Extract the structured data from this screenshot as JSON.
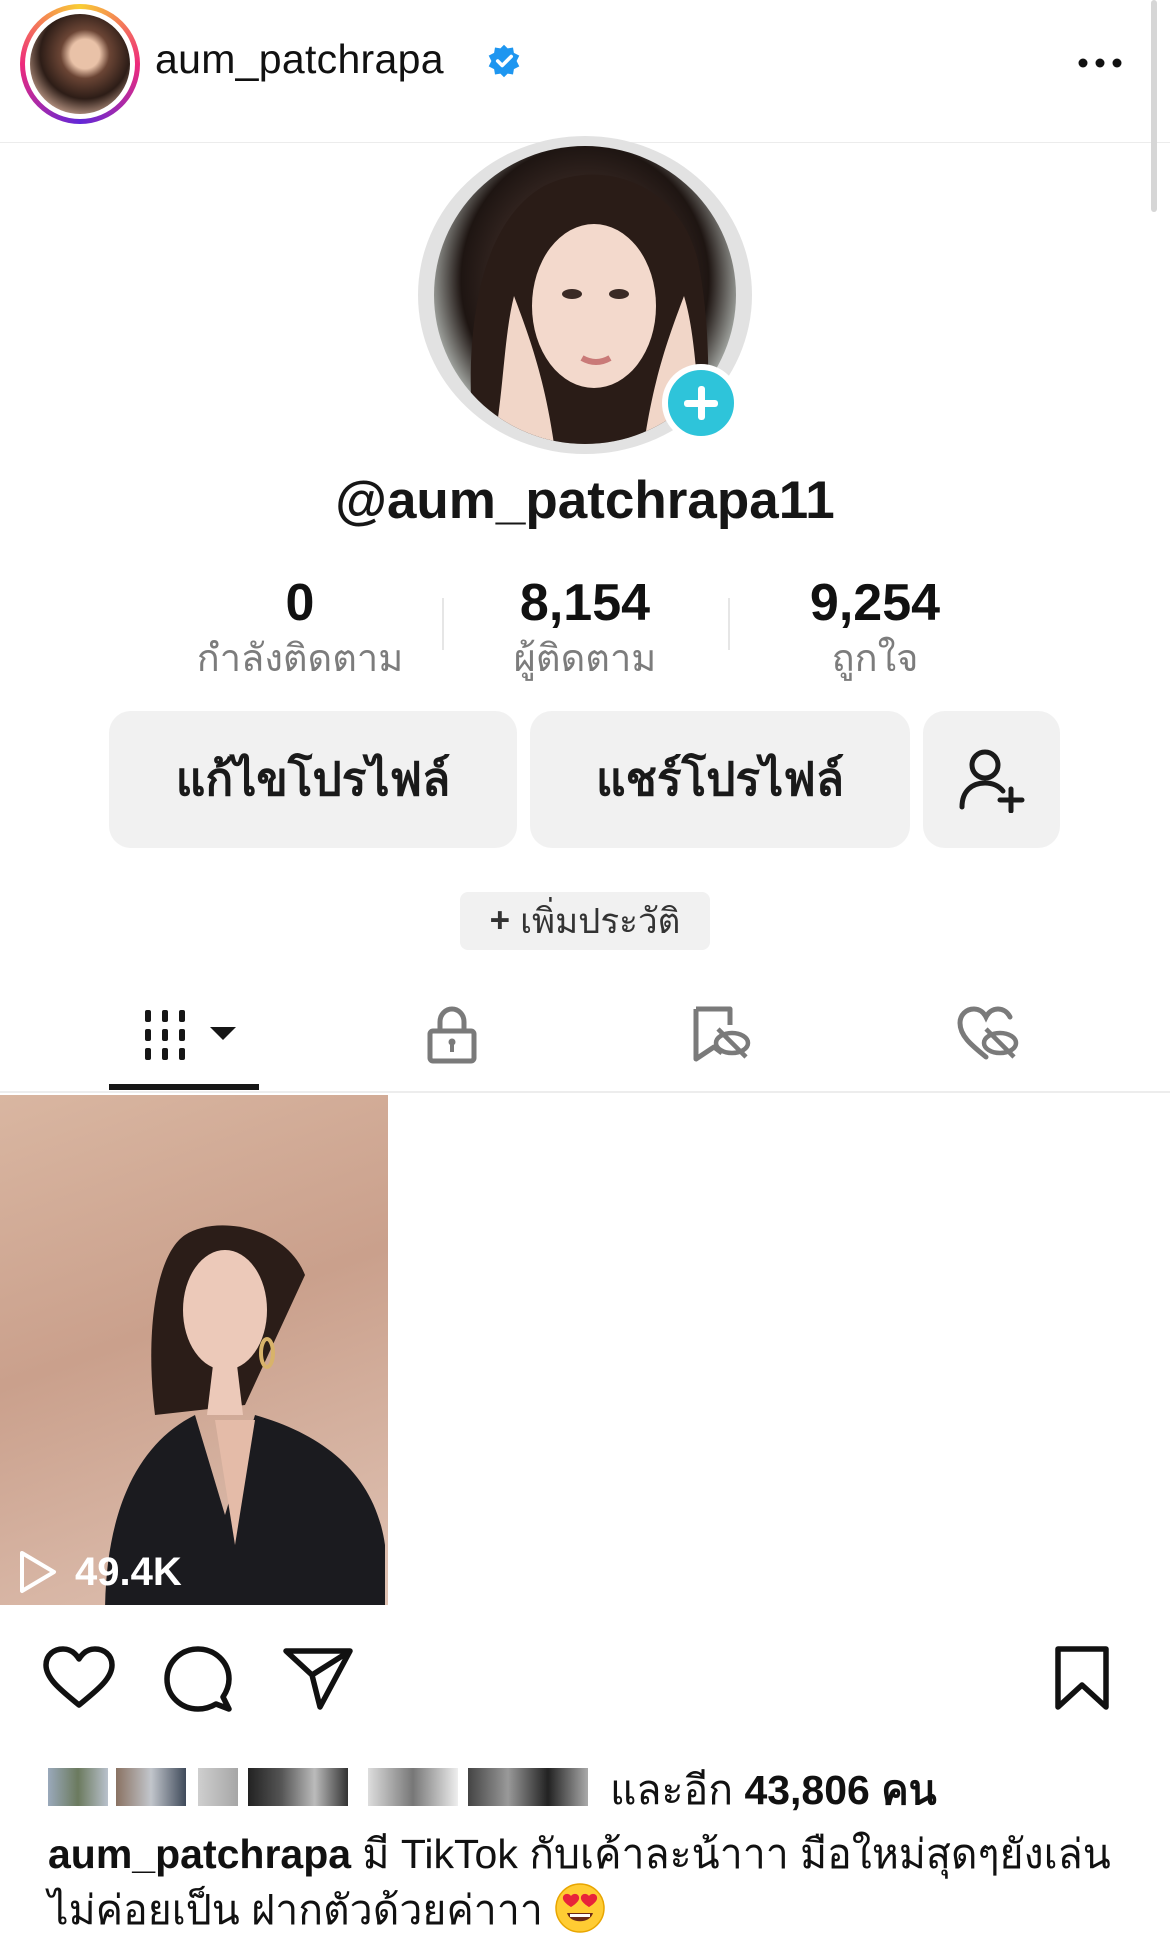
{
  "ig_header": {
    "username": "aum_patchrapa",
    "verified": true,
    "more_icon": "more-horizontal-icon"
  },
  "tiktok_profile": {
    "handle": "@aum_patchrapa11",
    "stats": [
      {
        "value": "0",
        "label": "กำลังติดตาม"
      },
      {
        "value": "8,154",
        "label": "ผู้ติดตาม"
      },
      {
        "value": "9,254",
        "label": "ถูกใจ"
      }
    ],
    "buttons": {
      "edit_profile": "แก้ไขโปรไฟล์",
      "share_profile": "แชร์โปรไฟล์",
      "add_friend_icon": "add-person-icon"
    },
    "add_bio": {
      "plus": "+",
      "label": "เพิ่มประวัติ"
    },
    "tabs": [
      "videos-grid-icon",
      "lock-icon",
      "hidden-bookmark-icon",
      "hidden-heart-icon"
    ],
    "video": {
      "views": "49.4K"
    },
    "accent_color": "#2ec4da"
  },
  "ig_post": {
    "actions": [
      "heart-icon",
      "comment-icon",
      "share-icon",
      "bookmark-icon"
    ],
    "likes": {
      "prefix": "และอีก",
      "count": "43,806",
      "suffix": "คน"
    },
    "caption": {
      "user": "aum_patchrapa",
      "text": "มี TikTok กับเค้าละน้าาา มือใหม่สุดๆยังเล่นไม่ค่อยเป็น ฝากตัวด้วยค่าาา"
    }
  }
}
